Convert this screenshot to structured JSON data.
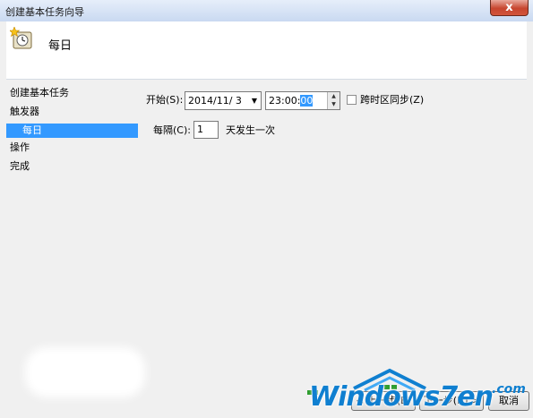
{
  "window": {
    "title": "创建基本任务向导",
    "close_glyph": "x"
  },
  "header": {
    "title": "每日",
    "icon": "clock-star-icon"
  },
  "sidebar": {
    "items": [
      {
        "label": "创建基本任务"
      },
      {
        "label": "触发器"
      },
      {
        "label": "每日"
      },
      {
        "label": "操作"
      },
      {
        "label": "完成"
      }
    ],
    "active_index": 2
  },
  "form": {
    "start_label": "开始(S):",
    "date_value": "2014/11/ 3",
    "time_prefix": "23:00:",
    "time_selected": "00",
    "sync_label": "跨时区同步(Z)",
    "sync_checked": false,
    "recur_label": "每隔(C):",
    "recur_value": "1",
    "recur_suffix": "天发生一次"
  },
  "buttons": {
    "back": "< 上一步(B)",
    "next": "下一步(N) >",
    "cancel": "取消"
  },
  "watermark": {
    "text": "Windows7en",
    "suffix": ".com"
  }
}
